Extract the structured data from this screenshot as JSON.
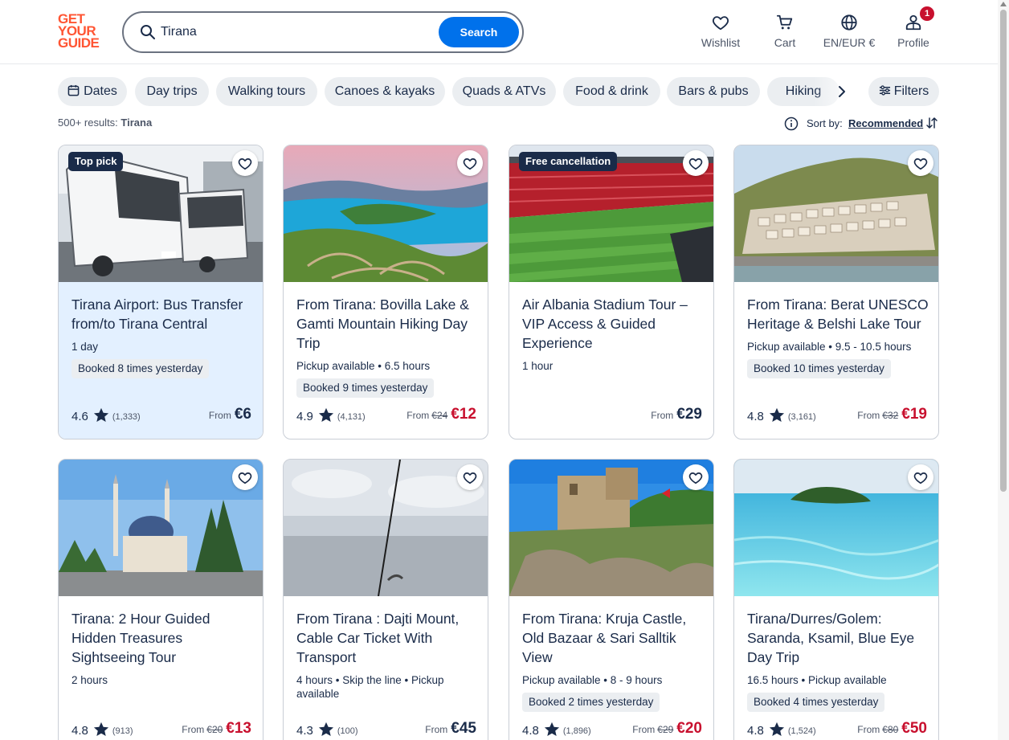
{
  "logo": {
    "lines": [
      "GET",
      "YOUR",
      "GUIDE"
    ]
  },
  "search": {
    "value": "Tirana",
    "button_label": "Search"
  },
  "nav": {
    "wishlist": "Wishlist",
    "cart": "Cart",
    "language": "EN/EUR €",
    "profile": "Profile",
    "profile_badge": "1"
  },
  "chips": [
    "Dates",
    "Day trips",
    "Walking tours",
    "Canoes & kayaks",
    "Quads & ATVs",
    "Food & drink",
    "Bars & pubs",
    "Hiking"
  ],
  "filters_label": "Filters",
  "results": {
    "count": "500+ results:",
    "query": "Tirana"
  },
  "sort": {
    "label": "Sort by:",
    "value": "Recommended"
  },
  "colors": {
    "brand": "#ff5533",
    "primary": "#0071eb",
    "sale": "#c8102e",
    "text": "#1a2b49"
  },
  "cards": [
    {
      "badge": "Top pick",
      "title": "Tirana Airport: Bus Transfer from/to Tirana Central",
      "meta": "1 day",
      "booked": "Booked 8 times yesterday",
      "rating": "4.6",
      "reviews": "(1,333)",
      "from": "From",
      "old_price": "",
      "price": "€6"
    },
    {
      "badge": "",
      "title": "From Tirana: Bovilla Lake & Gamti Mountain Hiking Day Trip",
      "meta": "Pickup available • 6.5 hours",
      "booked": "Booked 9 times yesterday",
      "rating": "4.9",
      "reviews": "(4,131)",
      "from": "From",
      "old_price": "€24",
      "price": "€12"
    },
    {
      "badge": "Free cancellation",
      "title": "Air Albania Stadium Tour – VIP Access & Guided Experience",
      "meta": "1 hour",
      "booked": "",
      "rating": "",
      "reviews": "",
      "from": "From",
      "old_price": "",
      "price": "€29"
    },
    {
      "badge": "",
      "title": "From Tirana: Berat UNESCO Heritage & Belshi Lake Tour",
      "meta": "Pickup available • 9.5 - 10.5 hours",
      "booked": "Booked 10 times yesterday",
      "rating": "4.8",
      "reviews": "(3,161)",
      "from": "From",
      "old_price": "€32",
      "price": "€19"
    },
    {
      "badge": "",
      "title": "Tirana: 2 Hour Guided Hidden Treasures Sightseeing Tour",
      "meta": "2 hours",
      "booked": "",
      "rating": "4.8",
      "reviews": "(913)",
      "from": "From",
      "old_price": "€20",
      "price": "€13"
    },
    {
      "badge": "",
      "title": "From Tirana : Dajti Mount, Cable Car Ticket With Transport",
      "meta": "4 hours • Skip the line • Pickup available",
      "booked": "",
      "rating": "4.3",
      "reviews": "(100)",
      "from": "From",
      "old_price": "",
      "price": "€45"
    },
    {
      "badge": "",
      "title": "From Tirana: Kruja Castle, Old Bazaar & Sari Salltik View",
      "meta": "Pickup available • 8 - 9 hours",
      "booked": "Booked 2 times yesterday",
      "rating": "4.8",
      "reviews": "(1,896)",
      "from": "From",
      "old_price": "€29",
      "price": "€20"
    },
    {
      "badge": "",
      "title": "Tirana/Durres/Golem: Saranda, Ksamil, Blue Eye Day Trip",
      "meta": "16.5 hours • Pickup available",
      "booked": "Booked 4 times yesterday",
      "rating": "4.8",
      "reviews": "(1,524)",
      "from": "From",
      "old_price": "€80",
      "price": "€50"
    }
  ]
}
